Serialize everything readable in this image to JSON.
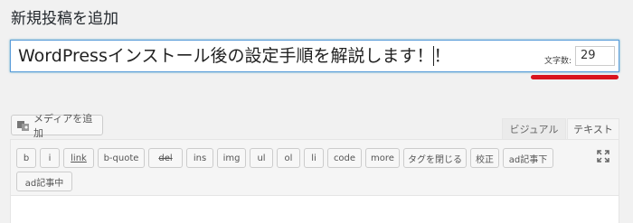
{
  "page": {
    "title": "新規投稿を追加"
  },
  "post_title": {
    "value": "WordPressインストール後の設定手順を解説します！！"
  },
  "char_count": {
    "label": "文字数:",
    "value": "29"
  },
  "media": {
    "add_label": "メディアを追加",
    "icon": "media-icon"
  },
  "editor_tabs": {
    "visual": "ビジュアル",
    "text": "テキスト"
  },
  "quicktags": {
    "b": "b",
    "i": "i",
    "link": "link",
    "bquote": "b-quote",
    "del": "del",
    "ins": "ins",
    "img": "img",
    "ul": "ul",
    "ol": "ol",
    "li": "li",
    "code": "code",
    "more": "more",
    "close_tags": "タグを閉じる",
    "proofread": "校正",
    "ad_bottom": "ad記事下",
    "ad_middle": "ad記事中"
  },
  "icons": {
    "fullscreen": "fullscreen-icon"
  },
  "colors": {
    "accent_border": "#5b9dd9",
    "annotation_red": "#d9141d"
  }
}
